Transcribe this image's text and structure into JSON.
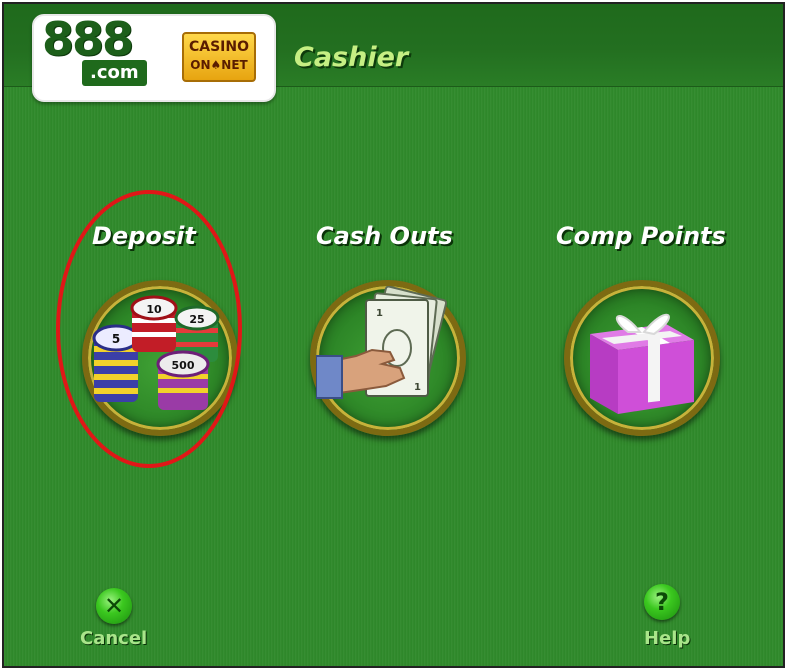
{
  "header": {
    "logo": {
      "number": "888",
      "domain": ".com",
      "badge_line1": "CASINO",
      "badge_line2": "ON♠NET"
    },
    "title": "Cashier"
  },
  "options": [
    {
      "label": "Deposit",
      "icon": "casino-chips-icon",
      "highlighted": true
    },
    {
      "label": "Cash Outs",
      "icon": "hand-holding-cash-icon"
    },
    {
      "label": "Comp Points",
      "icon": "gift-box-icon"
    }
  ],
  "footer": {
    "cancel": {
      "label": "Cancel",
      "icon": "close-x-icon",
      "symbol": "✕"
    },
    "help": {
      "label": "Help",
      "icon": "question-mark-icon",
      "symbol": "?"
    }
  },
  "colors": {
    "background": "#2f8a2a",
    "title": "#c6ef83",
    "highlight_ring": "#e01717",
    "footer_label": "#a9e58a"
  }
}
